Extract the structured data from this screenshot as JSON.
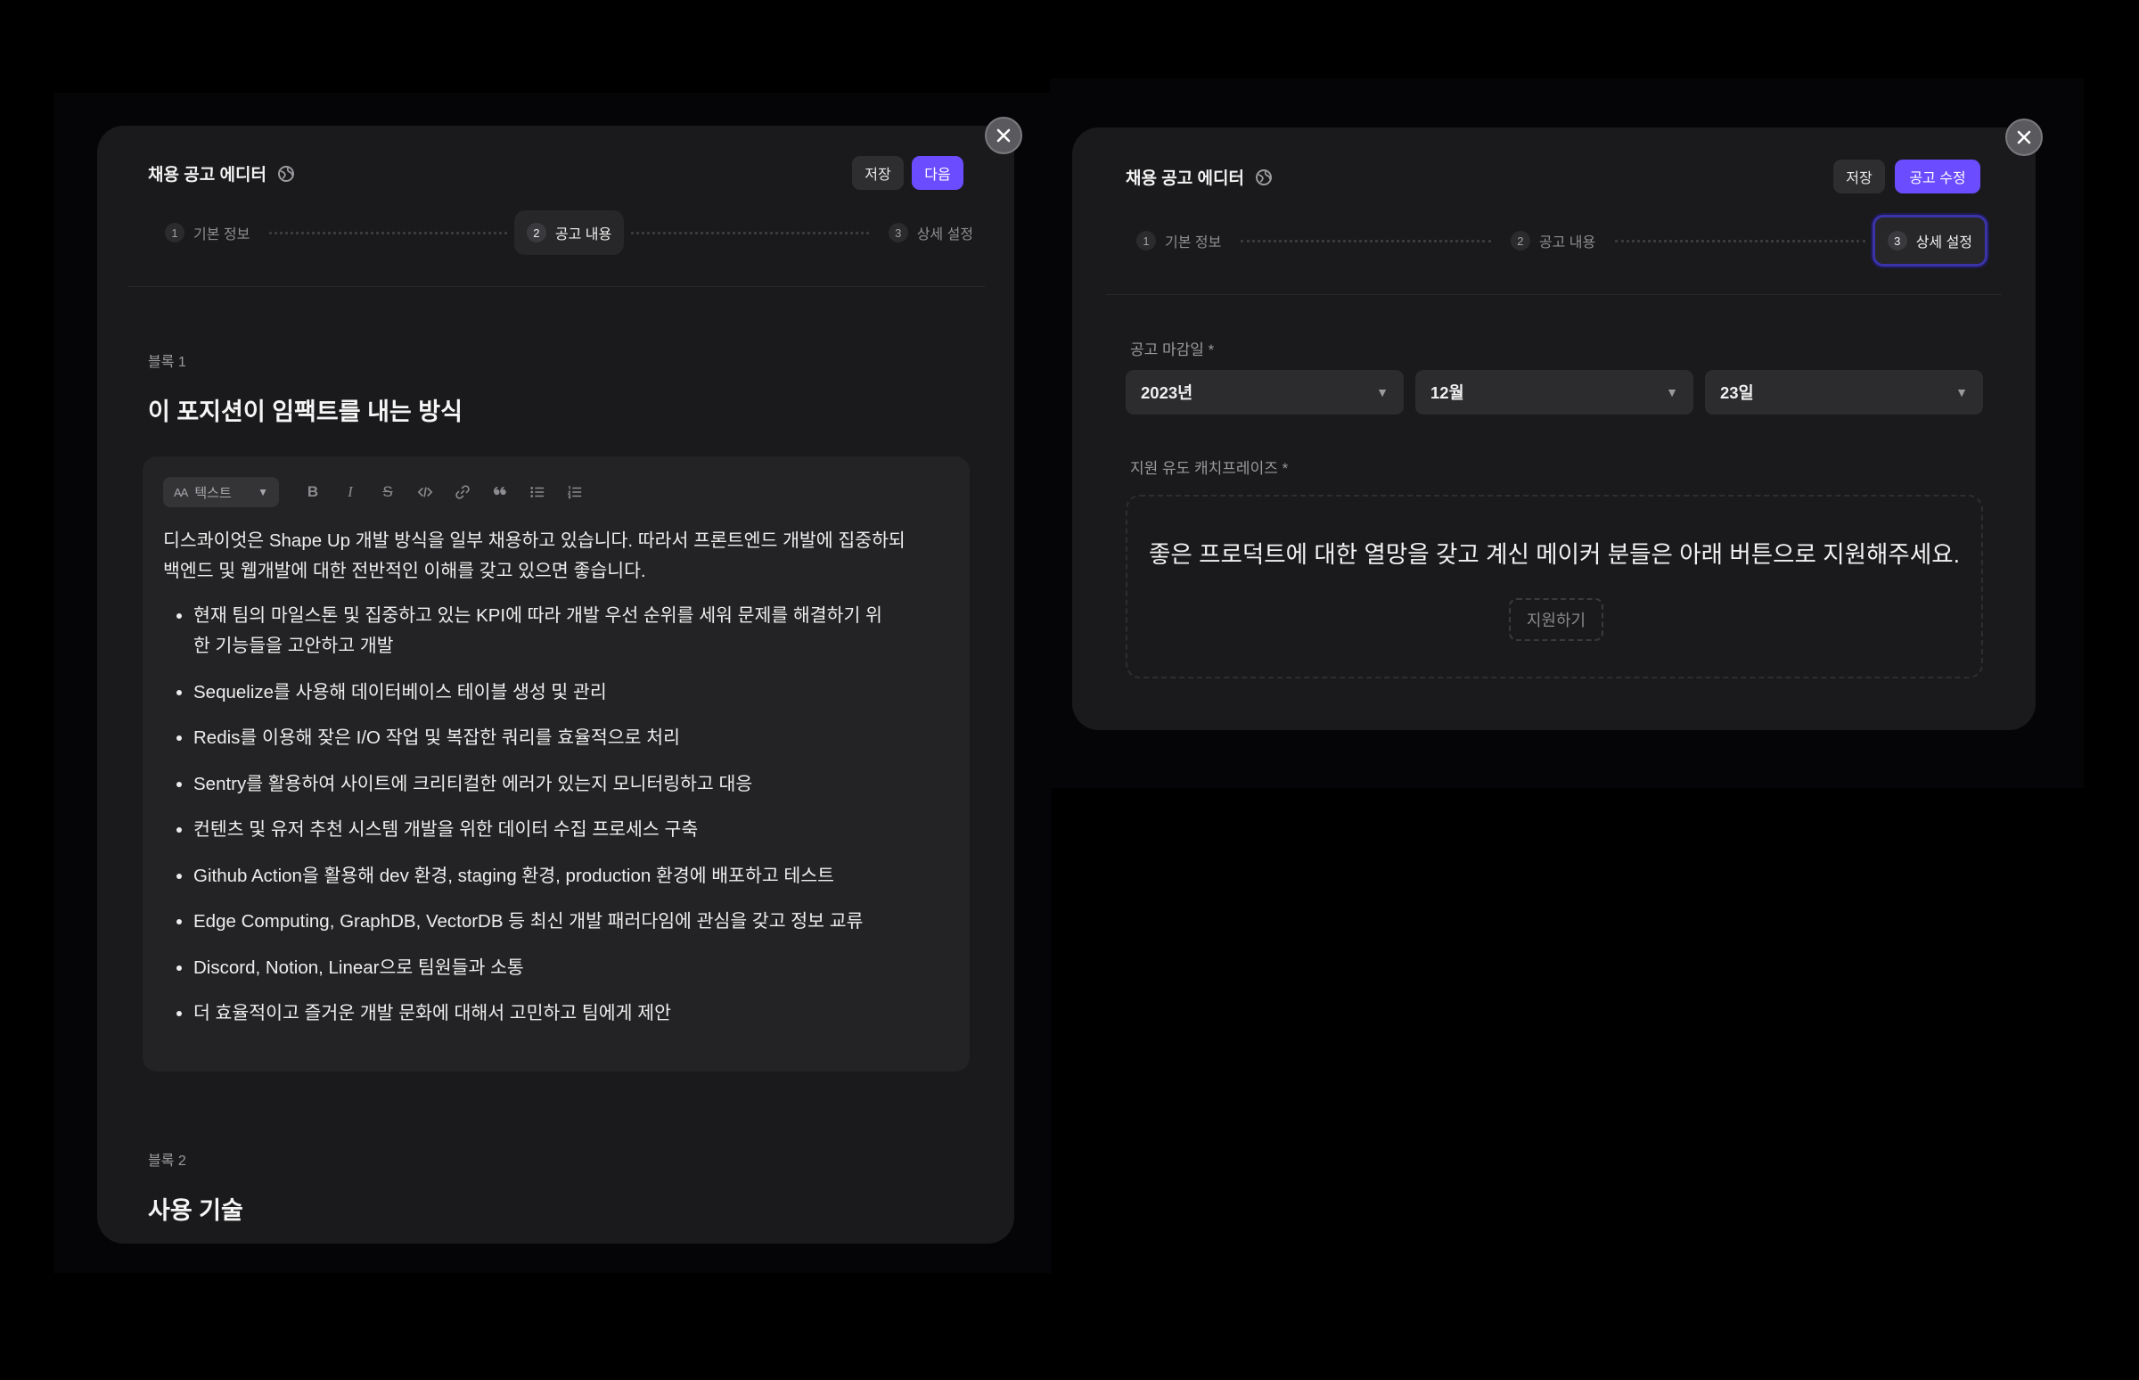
{
  "left_panel": {
    "title": "채용 공고 에디터",
    "save_label": "저장",
    "next_label": "다음",
    "steps": [
      {
        "num": "1",
        "label": "기본 정보"
      },
      {
        "num": "2",
        "label": "공고 내용"
      },
      {
        "num": "3",
        "label": "상세 설정"
      }
    ],
    "block1": {
      "label": "블록 1",
      "title": "이 포지션이 임팩트를 내는 방식",
      "format_select": "텍스트",
      "format_prefix": "AA",
      "paragraph_line1": "디스콰이엇은 Shape Up 개발 방식을 일부 채용하고 있습니다. 따라서 프론트엔드 개발에 집중하되",
      "paragraph_line2": "백엔드 및 웹개발에 대한 전반적인 이해를 갖고 있으면 좋습니다.",
      "bullets": [
        "현재 팀의 마일스톤 및 집중하고 있는 KPI에 따라 개발 우선 순위를 세워 문제를 해결하기 위한 기능들을 고안하고 개발",
        "Sequelize를 사용해 데이터베이스 테이블 생성 및 관리",
        "Redis를 이용해 잦은 I/O 작업 및 복잡한 쿼리를 효율적으로 처리",
        "Sentry를 활용하여 사이트에 크리티컬한 에러가 있는지 모니터링하고 대응",
        "컨텐츠 및 유저 추천 시스템 개발을 위한 데이터 수집 프로세스 구축",
        "Github Action을 활용해 dev 환경, staging 환경, production 환경에 배포하고 테스트",
        "Edge Computing, GraphDB, VectorDB 등 최신 개발 패러다임에 관심을 갖고 정보 교류",
        "Discord, Notion, Linear으로 팀원들과 소통",
        "더 효율적이고 즐거운 개발 문화에 대해서 고민하고 팀에게 제안"
      ]
    },
    "block2": {
      "label": "블록 2",
      "title": "사용 기술"
    }
  },
  "right_panel": {
    "title": "채용 공고 에디터",
    "save_label": "저장",
    "edit_label": "공고 수정",
    "steps": [
      {
        "num": "1",
        "label": "기본 정보"
      },
      {
        "num": "2",
        "label": "공고 내용"
      },
      {
        "num": "3",
        "label": "상세 설정"
      }
    ],
    "deadline_label": "공고 마감일 *",
    "deadline": {
      "year": "2023년",
      "month": "12월",
      "day": "23일"
    },
    "cta_label": "지원 유도 캐치프레이즈 *",
    "cta_text": "좋은 프로덕트에 대한 열망을 갖고 계신 메이커 분들은 아래 버튼으로 지원해주세요.",
    "apply_label": "지원하기"
  },
  "icons": {
    "close": "close-icon",
    "globe": "globe-icon",
    "bold": "bold-icon",
    "italic": "italic-icon",
    "strike": "strikethrough-icon",
    "code": "code-icon",
    "link": "link-icon",
    "quote": "quote-icon",
    "bullet_list": "bullet-list-icon",
    "ordered_list": "ordered-list-icon"
  },
  "colors": {
    "accent": "#6b4dff",
    "panel": "#1a1a1c",
    "background": "#000000"
  }
}
